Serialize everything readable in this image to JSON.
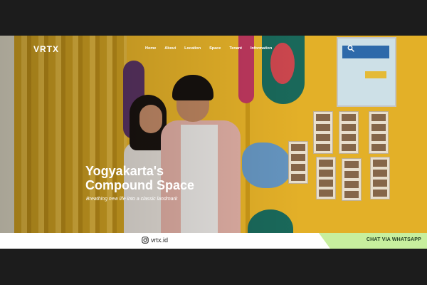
{
  "brand": {
    "logo": "VRTX"
  },
  "nav": {
    "items": [
      "Home",
      "About",
      "Location",
      "Space",
      "Tenant",
      "Information"
    ],
    "search_icon": "search-icon"
  },
  "hero": {
    "title_line1": "Yogyakarta's",
    "title_line2": "Compound Space",
    "subtitle": "Breathing new life into a classic landmark"
  },
  "footer": {
    "instagram_handle": "vrtx.id",
    "whatsapp_label": "CHAT VIA WHATSAPP",
    "instagram_icon": "instagram-icon"
  },
  "colors": {
    "whatsapp_bg": "#c7ef9e",
    "bar_bg": "#ffffff",
    "text": "#ffffff"
  }
}
